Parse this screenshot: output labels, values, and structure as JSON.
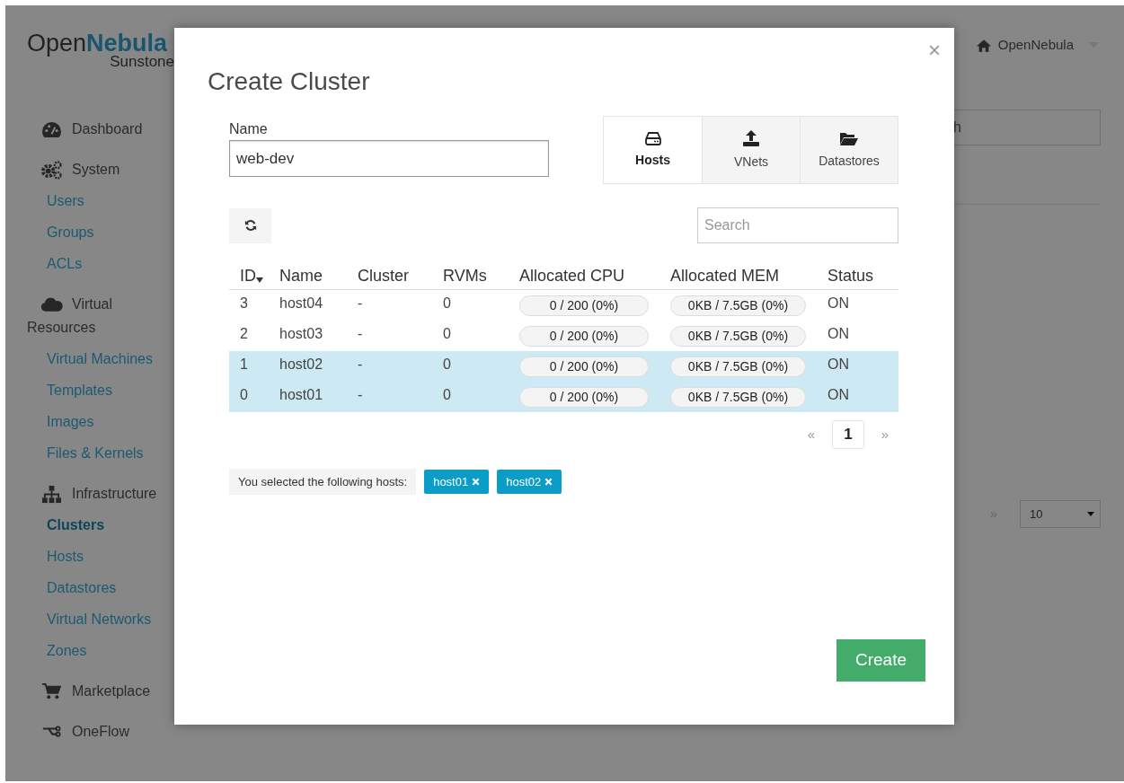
{
  "sidebar": {
    "logo": {
      "brand_start": "Open",
      "brand_end": "Nebula",
      "subtitle": "Sunstone"
    },
    "sections": [
      {
        "label": "Dashboard"
      },
      {
        "label": "System",
        "children": [
          {
            "label": "Users",
            "selected": false
          },
          {
            "label": "Groups",
            "selected": false
          },
          {
            "label": "ACLs",
            "selected": false
          }
        ]
      },
      {
        "label": "Virtual Resources",
        "children": [
          {
            "label": "Virtual Machines",
            "selected": false
          },
          {
            "label": "Templates",
            "selected": false
          },
          {
            "label": "Images",
            "selected": false
          },
          {
            "label": "Files & Kernels",
            "selected": false
          }
        ]
      },
      {
        "label": "Infrastructure",
        "children": [
          {
            "label": "Clusters",
            "selected": true
          },
          {
            "label": "Hosts",
            "selected": false
          },
          {
            "label": "Datastores",
            "selected": false
          },
          {
            "label": "Virtual Networks",
            "selected": false
          },
          {
            "label": "Zones",
            "selected": false
          }
        ]
      },
      {
        "label": "Marketplace"
      },
      {
        "label": "OneFlow"
      }
    ]
  },
  "header": {
    "user_menu": "OpenNebula",
    "search_placeholder": "h"
  },
  "background_list": {
    "next_page": "»",
    "page_size": "10"
  },
  "dialog": {
    "title": "Create Cluster",
    "close": "×",
    "name_field": {
      "label": "Name",
      "value": "web-dev"
    },
    "tabs": [
      {
        "label": "Hosts",
        "selected": true
      },
      {
        "label": "VNets",
        "selected": false
      },
      {
        "label": "Datastores",
        "selected": false
      }
    ],
    "search_placeholder": "Search",
    "table": {
      "columns": [
        "ID",
        "Name",
        "Cluster",
        "RVMs",
        "Allocated CPU",
        "Allocated MEM",
        "Status"
      ],
      "rows": [
        {
          "id": "3",
          "name": "host04",
          "cluster": "-",
          "rvms": "0",
          "cpu": {
            "reading": "0 / 200 (0%)",
            "level": 0
          },
          "mem": {
            "reading": "0KB / 7.5GB (0%)",
            "level": 0
          },
          "status": "ON",
          "selected": false
        },
        {
          "id": "2",
          "name": "host03",
          "cluster": "-",
          "rvms": "0",
          "cpu": {
            "reading": "0 / 200 (0%)",
            "level": 0
          },
          "mem": {
            "reading": "0KB / 7.5GB (0%)",
            "level": 0
          },
          "status": "ON",
          "selected": false
        },
        {
          "id": "1",
          "name": "host02",
          "cluster": "-",
          "rvms": "0",
          "cpu": {
            "reading": "0 / 200 (0%)",
            "level": 0
          },
          "mem": {
            "reading": "0KB / 7.5GB (0%)",
            "level": 0
          },
          "status": "ON",
          "selected": true
        },
        {
          "id": "0",
          "name": "host01",
          "cluster": "-",
          "rvms": "0",
          "cpu": {
            "reading": "0 / 200 (0%)",
            "level": 0
          },
          "mem": {
            "reading": "0KB / 7.5GB (0%)",
            "level": 0
          },
          "status": "ON",
          "selected": true
        }
      ]
    },
    "pagination": {
      "previous": "«",
      "page": "1",
      "next": "»"
    },
    "selection": {
      "label": "You selected the following hosts:",
      "tags": [
        "host01",
        "host02"
      ]
    },
    "create_button": "Create"
  }
}
